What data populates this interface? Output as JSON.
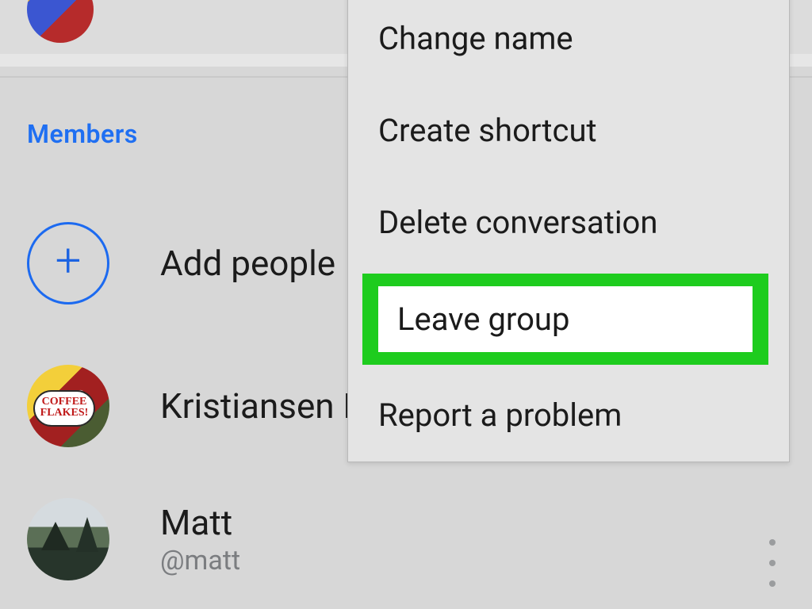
{
  "header": {
    "section_label": "Members"
  },
  "actions": {
    "add_label": "Add people"
  },
  "members": [
    {
      "name": "Kristiansen L",
      "avatar_bubble": "COFFEE FLAKES!"
    },
    {
      "name": "Matt",
      "handle": "@matt"
    }
  ],
  "menu": {
    "items": [
      {
        "label": "Change name"
      },
      {
        "label": "Create shortcut"
      },
      {
        "label": "Delete conversation"
      },
      {
        "label": "Leave group",
        "highlighted": true
      },
      {
        "label": "Report a problem"
      }
    ]
  }
}
